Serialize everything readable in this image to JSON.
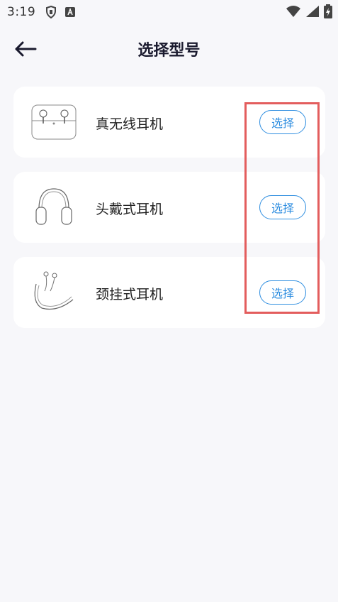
{
  "status_bar": {
    "time": "3:19"
  },
  "header": {
    "title": "选择型号"
  },
  "models": [
    {
      "label": "真无线耳机",
      "button": "选择",
      "image": "true-wireless-earbuds-icon"
    },
    {
      "label": "头戴式耳机",
      "button": "选择",
      "image": "over-ear-headphones-icon"
    },
    {
      "label": "颈挂式耳机",
      "button": "选择",
      "image": "neckband-earphones-icon"
    }
  ],
  "colors": {
    "accent": "#2f8ee0",
    "highlight": "#e35d5d",
    "background": "#f7f7fa"
  }
}
